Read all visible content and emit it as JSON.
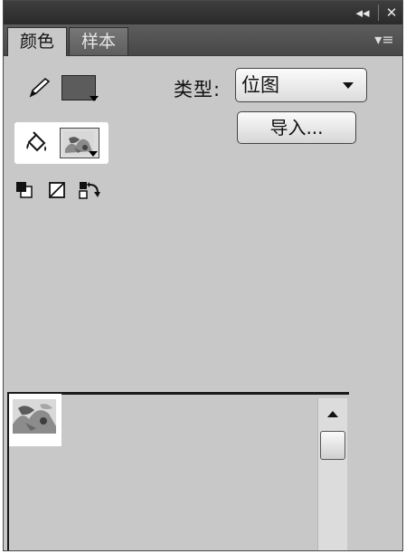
{
  "titlebar": {
    "collapse_glyph": "◂◂",
    "close_glyph": "✕"
  },
  "tabs": [
    {
      "label": "颜色",
      "active": true
    },
    {
      "label": "样本",
      "active": false
    }
  ],
  "panel_menu_glyph": "▾≡",
  "type_label": "类型:",
  "type_select": {
    "value": "位图"
  },
  "import_button": "导入...",
  "icons": [
    "pencil-icon",
    "paint-bucket-icon",
    "default-colors-icon",
    "no-color-icon",
    "swap-colors-icon",
    "collapse-icon",
    "close-icon",
    "panel-menu-icon"
  ],
  "colors": {
    "panel_bg": "#c8c8c8",
    "stroke_color": "#5c5c5c"
  }
}
